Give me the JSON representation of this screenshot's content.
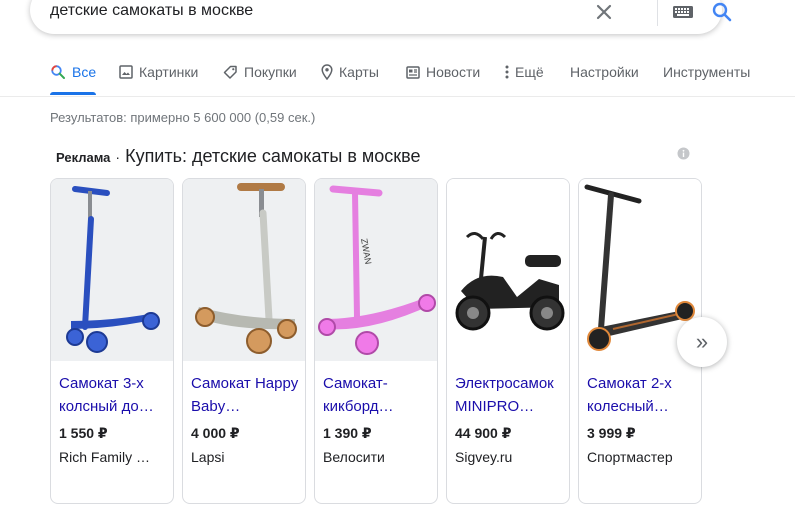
{
  "search": {
    "query": "детские самокаты в москве"
  },
  "tabs": [
    {
      "label": "Все",
      "icon": "search-icon"
    },
    {
      "label": "Картинки",
      "icon": "image-icon"
    },
    {
      "label": "Покупки",
      "icon": "tag-icon"
    },
    {
      "label": "Карты",
      "icon": "map-pin-icon"
    },
    {
      "label": "Новости",
      "icon": "news-icon"
    },
    {
      "label": "Ещё",
      "icon": "more-vertical-icon"
    },
    {
      "label": "Настройки"
    },
    {
      "label": "Инструменты"
    }
  ],
  "results_stats": "Результатов: примерно 5 600 000 (0,59 сек.)",
  "ads": {
    "label": "Реклама",
    "separator": "·",
    "title": "Купить: детские самокаты в москве",
    "products": [
      {
        "title": "Самокат 3-х колсный до…",
        "price": "1 550 ₽",
        "seller": "Rich Family …",
        "color": "#2a4fbf"
      },
      {
        "title": "Самокат Happy Baby…",
        "price": "4 000 ₽",
        "seller": "Lapsi",
        "color": "#b7b9b2"
      },
      {
        "title": "Самокат-кикборд…",
        "price": "1 390 ₽",
        "seller": "Велосити",
        "color": "#e57fe0"
      },
      {
        "title": "Электросамок MINIPRO…",
        "price": "44 900 ₽",
        "seller": "Sigvey.ru",
        "color": "#222222"
      },
      {
        "title": "Самокат 2-х колесный…",
        "price": "3 999 ₽",
        "seller": "Спортмастер",
        "color": "#333333"
      }
    ]
  },
  "colors": {
    "link": "#1a0dab",
    "accent": "#1a73e8",
    "muted": "#70757a"
  }
}
